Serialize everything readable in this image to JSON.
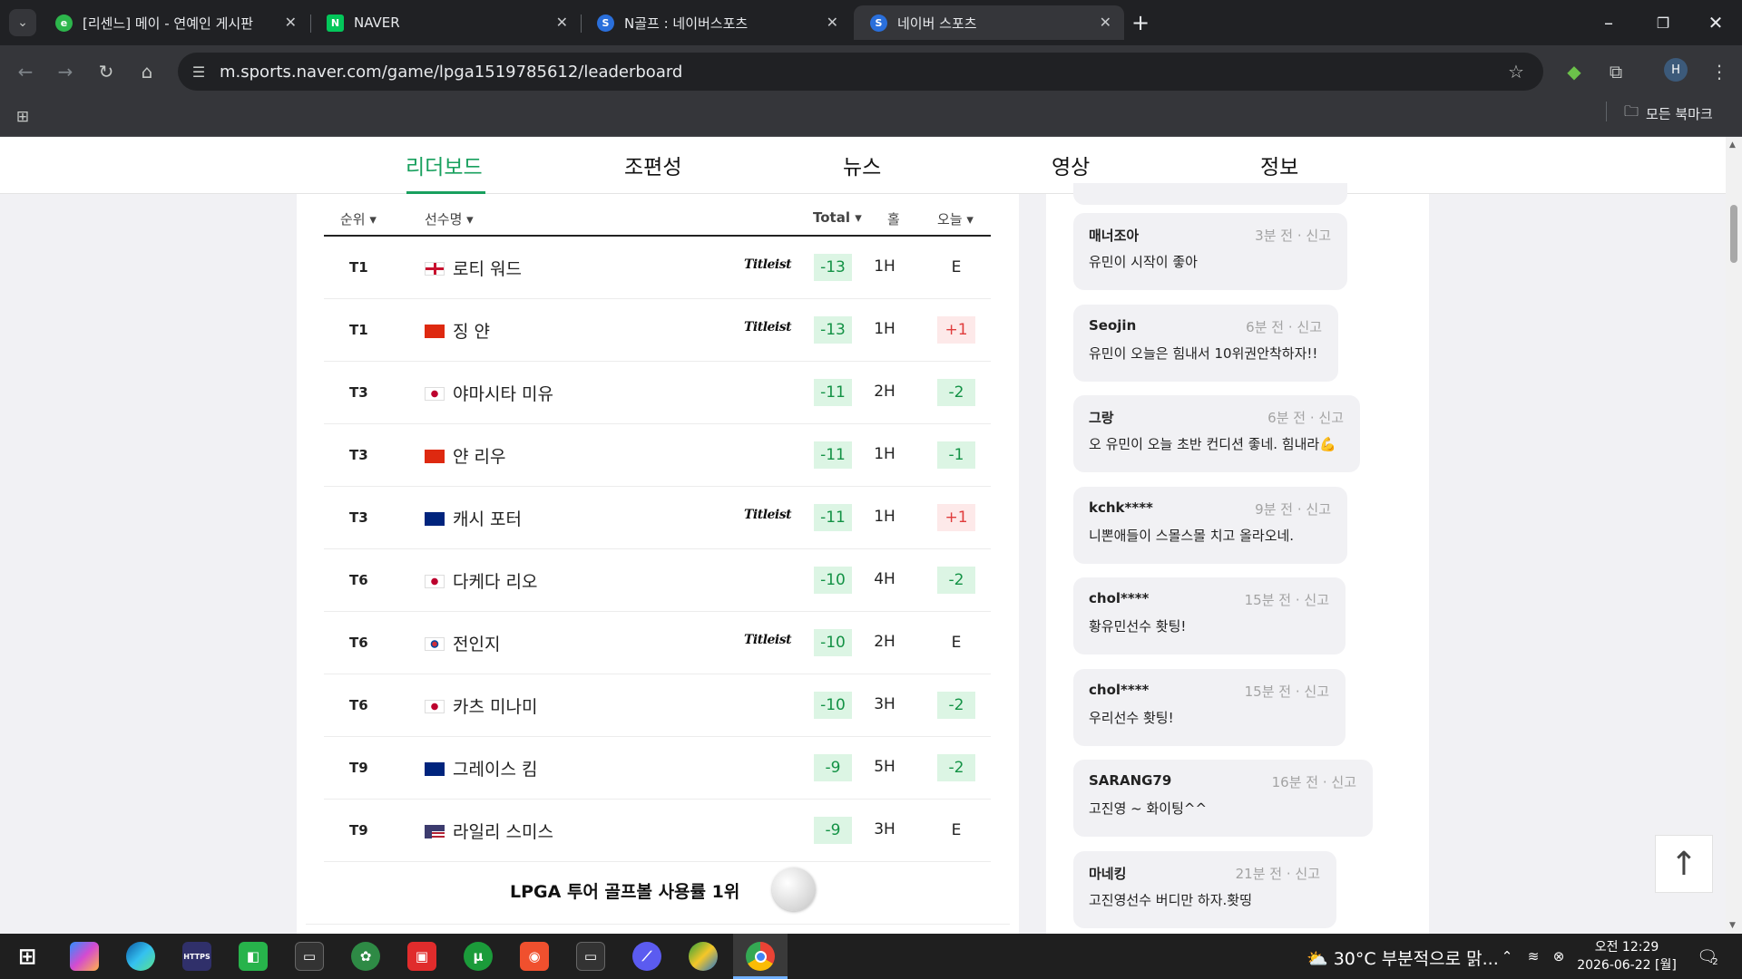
{
  "browser": {
    "tabs": [
      {
        "title": "[리센느] 메이 - 연예인 게시판",
        "fav": "e",
        "color": "#2db64c"
      },
      {
        "title": "NAVER",
        "fav": "N",
        "color": "#03c75a"
      },
      {
        "title": "N골프 : 네이버스포츠",
        "fav": "S",
        "color": "#2a6fdb"
      },
      {
        "title": "네이버 스포츠",
        "fav": "S",
        "color": "#2a6fdb"
      }
    ],
    "url": "m.sports.naver.com/game/lpga1519785612/leaderboard",
    "profile_initial": "H",
    "bookmarks_label": "모든 북마크"
  },
  "nav": {
    "tabs": [
      "리더보드",
      "조편성",
      "뉴스",
      "영상",
      "정보"
    ],
    "active": "리더보드"
  },
  "leaderboard": {
    "headers": {
      "rank": "순위",
      "name": "선수명",
      "total": "Total",
      "hole": "홀",
      "today": "오늘"
    },
    "rows": [
      {
        "rank": "T1",
        "country": "england",
        "name": "로티 워드",
        "brand": "Titleist",
        "total": "-13",
        "hole": "1H",
        "today": "E",
        "today_type": "even"
      },
      {
        "rank": "T1",
        "country": "china",
        "name": "징 얀",
        "brand": "Titleist",
        "total": "-13",
        "hole": "1H",
        "today": "+1",
        "today_type": "over"
      },
      {
        "rank": "T3",
        "country": "japan",
        "name": "야마시타 미유",
        "brand": "",
        "total": "-11",
        "hole": "2H",
        "today": "-2",
        "today_type": "under"
      },
      {
        "rank": "T3",
        "country": "china",
        "name": "얀 리우",
        "brand": "",
        "total": "-11",
        "hole": "1H",
        "today": "-1",
        "today_type": "under"
      },
      {
        "rank": "T3",
        "country": "australia",
        "name": "캐시 포터",
        "brand": "Titleist",
        "total": "-11",
        "hole": "1H",
        "today": "+1",
        "today_type": "over"
      },
      {
        "rank": "T6",
        "country": "japan",
        "name": "다케다 리오",
        "brand": "",
        "total": "-10",
        "hole": "4H",
        "today": "-2",
        "today_type": "under"
      },
      {
        "rank": "T6",
        "country": "korea",
        "name": "전인지",
        "brand": "Titleist",
        "total": "-10",
        "hole": "2H",
        "today": "E",
        "today_type": "even"
      },
      {
        "rank": "T6",
        "country": "japan",
        "name": "카츠 미나미",
        "brand": "",
        "total": "-10",
        "hole": "3H",
        "today": "-2",
        "today_type": "under"
      },
      {
        "rank": "T9",
        "country": "australia",
        "name": "그레이스 킴",
        "brand": "",
        "total": "-9",
        "hole": "5H",
        "today": "-2",
        "today_type": "under"
      },
      {
        "rank": "T9",
        "country": "usa",
        "name": "라일리 스미스",
        "brand": "",
        "total": "-9",
        "hole": "3H",
        "today": "E",
        "today_type": "even"
      }
    ],
    "ad_text": "LPGA 투어 골프볼 사용률 1위"
  },
  "comments": [
    {
      "author": "매너조아",
      "time": "3분 전",
      "report": "신고",
      "body": "유민이 시작이 좋아"
    },
    {
      "author": "Seojin",
      "time": "6분 전",
      "report": "신고",
      "body": "유민이 오늘은 힘내서 10위권안착하자!!"
    },
    {
      "author": "그랑",
      "time": "6분 전",
      "report": "신고",
      "body": "오 유민이 오늘 초반 컨디션 좋네. 힘내라💪"
    },
    {
      "author": "kchk****",
      "time": "9분 전",
      "report": "신고",
      "body": "니뽄애들이 스몰스몰 치고 올라오네."
    },
    {
      "author": "chol****",
      "time": "15분 전",
      "report": "신고",
      "body": "황유민선수 홧팅!"
    },
    {
      "author": "chol****",
      "time": "15분 전",
      "report": "신고",
      "body": "우리선수 홧팅!"
    },
    {
      "author": "SARANG79",
      "time": "16분 전",
      "report": "신고",
      "body": "고진영 ~ 화이팅^^"
    },
    {
      "author": "마네킹",
      "time": "21분 전",
      "report": "신고",
      "body": "고진영선수 버디만 하자.홧띵"
    }
  ],
  "taskbar": {
    "weather": "30°C 부분적으로 맑...",
    "time": "오전 12:29",
    "date": "2026-06-22 [월]",
    "notification_count": "2"
  }
}
